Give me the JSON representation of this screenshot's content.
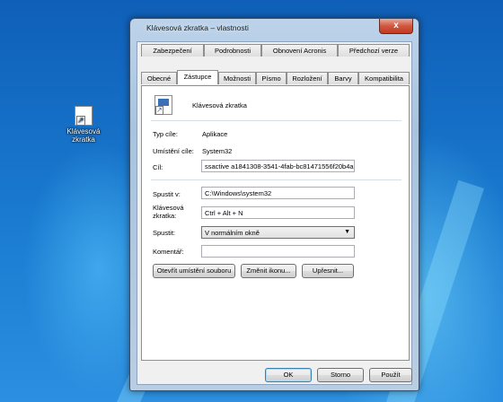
{
  "desktop": {
    "icon_label": "Klávesová zkratka"
  },
  "window": {
    "title": "Klávesová zkratka – vlastnosti",
    "close_glyph": "x",
    "tabs_row1": [
      "Zabezpečení",
      "Podrobnosti",
      "Obnovení Acronis",
      "Předchozí verze"
    ],
    "tabs_row2": [
      "Obecné",
      "Zástupce",
      "Možnosti",
      "Písmo",
      "Rozložení",
      "Barvy",
      "Kompatibilita"
    ],
    "active_tab": "Zástupce"
  },
  "shortcut": {
    "name": "Klávesová zkratka",
    "type_label": "Typ cíle:",
    "type_value": "Aplikace",
    "location_label": "Umístění cíle:",
    "location_value": "System32",
    "target_label": "Cíl:",
    "target_value": "ssactive a1841308-3541-4fab-bc81471556f20b4a",
    "start_in_label": "Spustit v:",
    "start_in_value": "C:\\Windows\\system32",
    "hotkey_label_line1": "Klávesová",
    "hotkey_label_line2": "zkratka:",
    "hotkey_value": "Ctrl + Alt + N",
    "run_label": "Spustit:",
    "run_value": "V normálním okně",
    "comment_label": "Komentář:",
    "comment_value": "",
    "open_location_button": "Otevřít umístění souboru",
    "change_icon_button": "Změnit ikonu...",
    "advanced_button": "Upřesnit..."
  },
  "footer": {
    "ok": "OK",
    "cancel": "Storno",
    "apply": "Použít"
  }
}
